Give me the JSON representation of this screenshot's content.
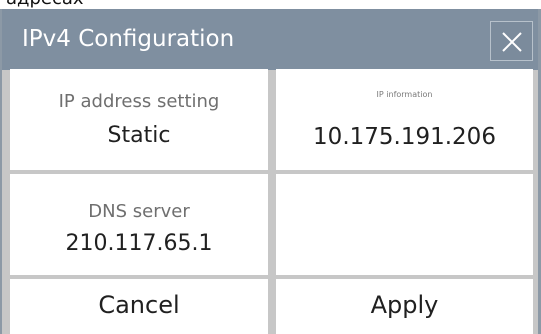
{
  "page": {
    "partial_heading": "адресах"
  },
  "dialog": {
    "title": "IPv4 Configuration",
    "close_icon": "close-icon",
    "fields": {
      "ip_address_setting": {
        "label": "IP address setting",
        "value": "Static"
      },
      "ip_information": {
        "label": "IP information",
        "value": "10.175.191.206"
      },
      "dns_server": {
        "label": "DNS server",
        "value": "210.117.65.1"
      }
    },
    "buttons": {
      "cancel": "Cancel",
      "apply": "Apply"
    }
  },
  "colors": {
    "title_bar": "#7f8fa0",
    "dialog_background": "#c7c7c7",
    "cell_background": "#ffffff",
    "label_text": "#6f6f6f",
    "value_text": "#202020"
  }
}
